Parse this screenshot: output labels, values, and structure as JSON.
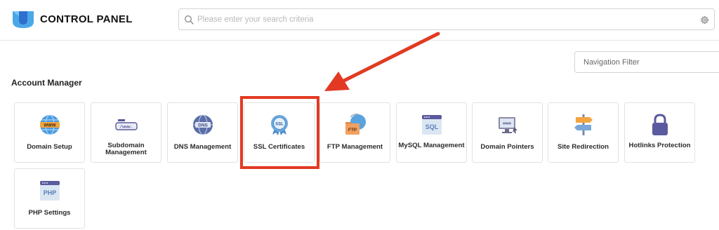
{
  "header": {
    "brand": "CONTROL PANEL",
    "search_placeholder": "Please enter your search criteria"
  },
  "nav_filter_placeholder": "Navigation Filter",
  "section_title": "Account Manager",
  "tiles": [
    {
      "label": "Domain Setup",
      "icon": "globe-www-icon"
    },
    {
      "label": "Subdomain Management",
      "icon": "subdomain-icon"
    },
    {
      "label": "DNS Management",
      "icon": "dns-globe-icon"
    },
    {
      "label": "SSL Certificates",
      "icon": "ssl-badge-icon"
    },
    {
      "label": "FTP Management",
      "icon": "ftp-folder-icon"
    },
    {
      "label": "MySQL Management",
      "icon": "sql-database-icon"
    },
    {
      "label": "Domain Pointers",
      "icon": "monitor-www-icon"
    },
    {
      "label": "Site Redirection",
      "icon": "signpost-icon"
    },
    {
      "label": "Hotlinks Protection",
      "icon": "padlock-icon"
    },
    {
      "label": "PHP Settings",
      "icon": "php-window-icon"
    }
  ],
  "colors": {
    "highlight": "#e23a22",
    "arrow": "#e23a22",
    "icon_blue": "#3b82c4",
    "icon_purple": "#5a5a9e"
  }
}
